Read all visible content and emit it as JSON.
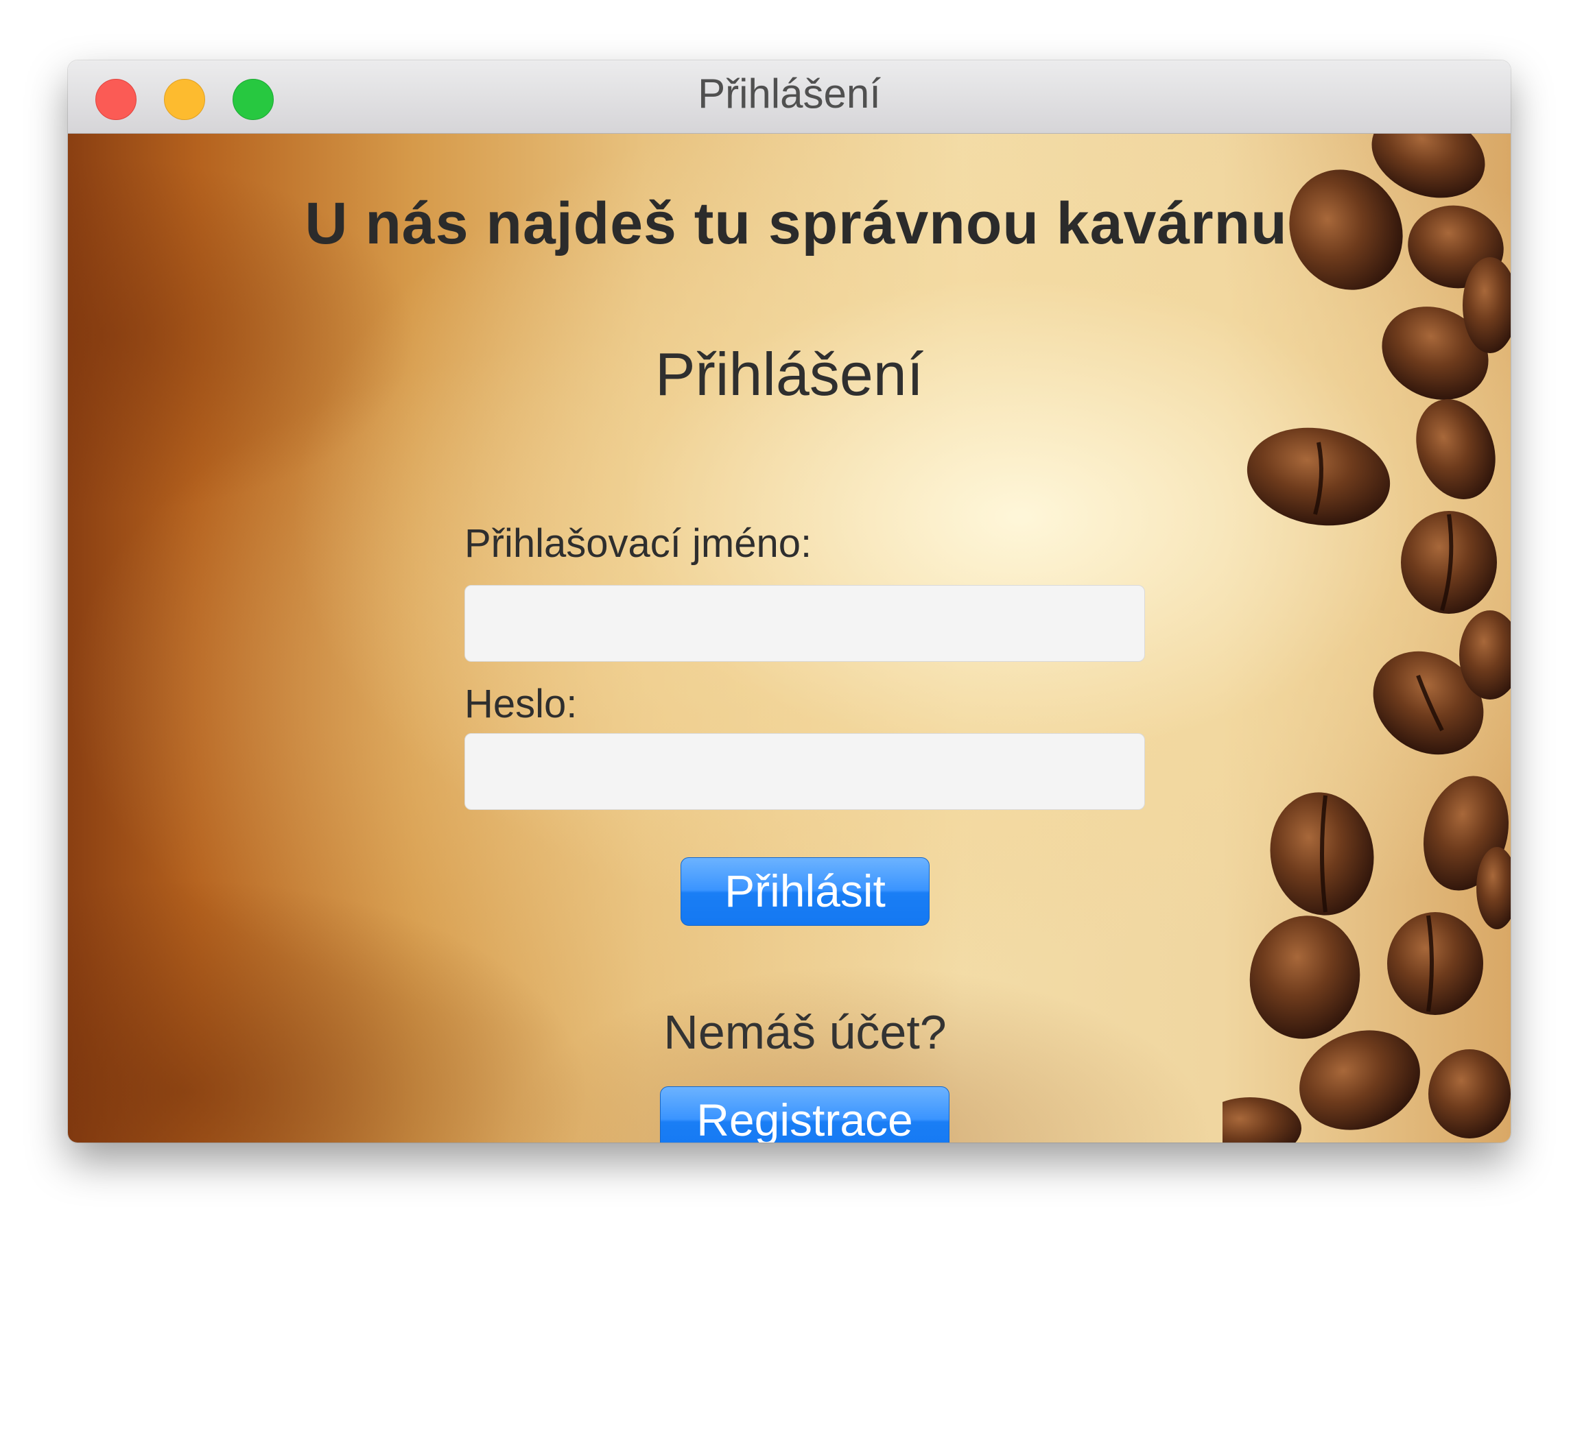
{
  "window": {
    "title": "Přihlášení"
  },
  "content": {
    "headline": "U nás najdeš tu správnou kavárnu",
    "form_title": "Přihlášení",
    "username_label": "Přihlašovací jméno:",
    "username_value": "",
    "password_label": "Heslo:",
    "password_value": "",
    "login_button": "Přihlásit",
    "no_account_prompt": "Nemáš účet?",
    "register_button": "Registrace"
  },
  "colors": {
    "button_blue": "#1a7ef5",
    "close": "#fb5b55",
    "minimize": "#fdbb2f",
    "maximize": "#27c840",
    "text": "#2b2b2b"
  },
  "icons": [
    "close-traffic-light",
    "minimize-traffic-light",
    "maximize-traffic-light"
  ]
}
